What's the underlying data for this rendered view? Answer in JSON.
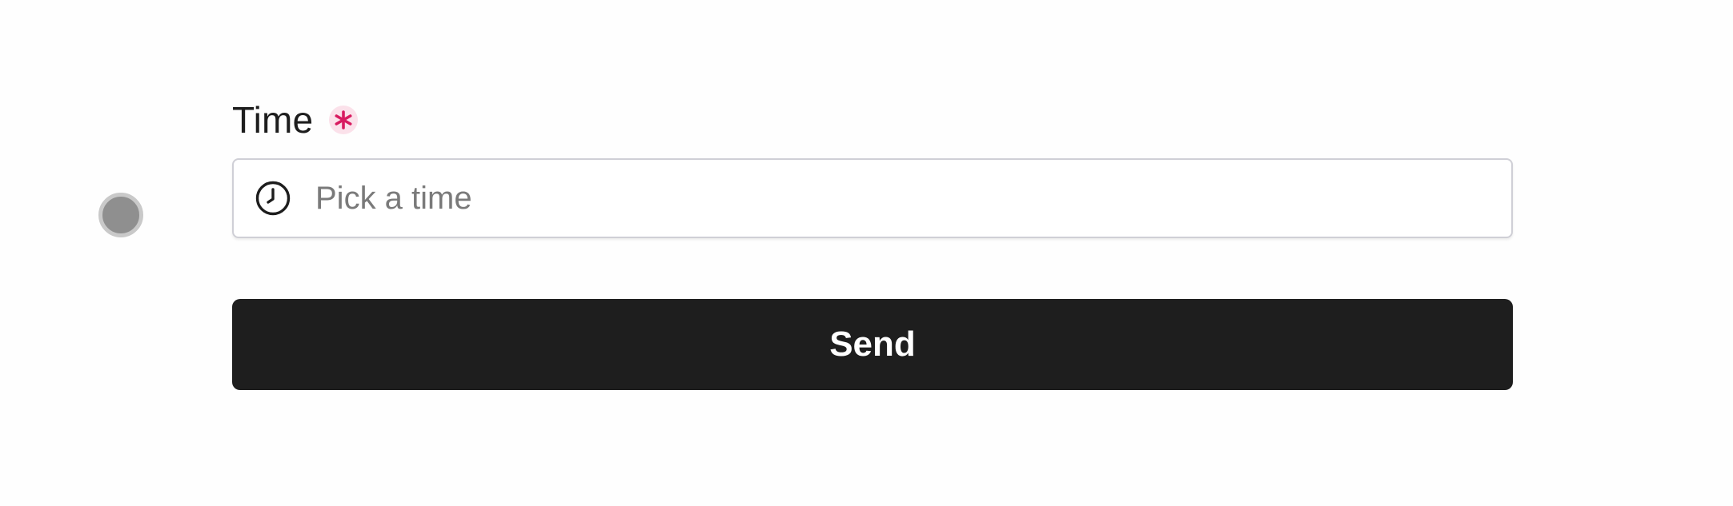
{
  "form": {
    "time_field": {
      "label": "Time",
      "required_marker": "*",
      "placeholder": "Pick a time",
      "value": "",
      "icon": "clock-icon"
    },
    "submit": {
      "label": "Send"
    }
  },
  "colors": {
    "required_accent": "#d81b60",
    "required_badge_bg": "#fbe1ea",
    "button_bg": "#1e1e1e",
    "button_text": "#ffffff",
    "input_border": "#cfcfd6",
    "cursor_indicator": "#8f8f8f"
  }
}
